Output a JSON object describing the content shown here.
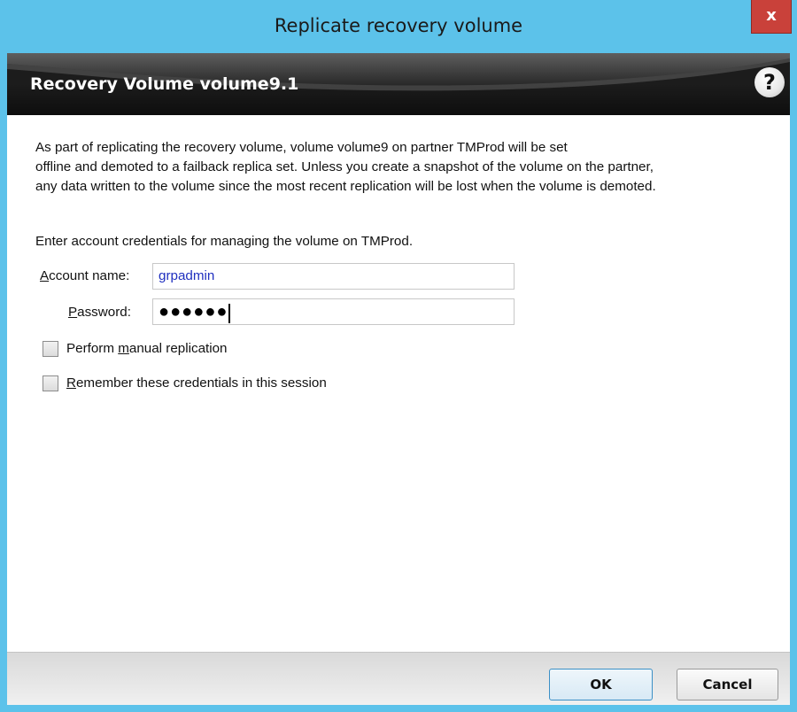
{
  "window": {
    "title": "Replicate recovery volume",
    "close_glyph": "x"
  },
  "banner": {
    "title": "Recovery Volume volume9.1",
    "help_glyph": "?"
  },
  "message": {
    "lines": [
      "As part of replicating the recovery volume, volume volume9 on partner TMProd will be set",
      "offline and demoted to a failback replica set.  Unless you create a snapshot of the volume on the partner,",
      "any data written to the volume since the most recent replication will be lost when the volume is demoted."
    ],
    "prompt": "Enter account credentials for managing the volume on TMProd."
  },
  "form": {
    "account_label_mnemonic": "A",
    "account_label_rest": "ccount name:",
    "account_value": "grpadmin",
    "password_label_mnemonic": "P",
    "password_label_rest": "assword:",
    "password_mask": "●●●●●●",
    "manual_replication_pre": "Perform ",
    "manual_replication_mnemonic": "m",
    "manual_replication_post": "anual replication",
    "manual_replication_checked": false,
    "remember_mnemonic": "R",
    "remember_rest": "emember these credentials in this session",
    "remember_checked": false
  },
  "footer": {
    "ok_label": "OK",
    "cancel_label": "Cancel"
  },
  "colors": {
    "window_frame": "#5cc2ea",
    "close_button": "#c9413a",
    "banner_bg": "#1c1c1c",
    "input_text": "#1f2fbf",
    "ok_border": "#3c90c6"
  },
  "icons": {
    "close": "close-icon",
    "help": "help-icon"
  }
}
